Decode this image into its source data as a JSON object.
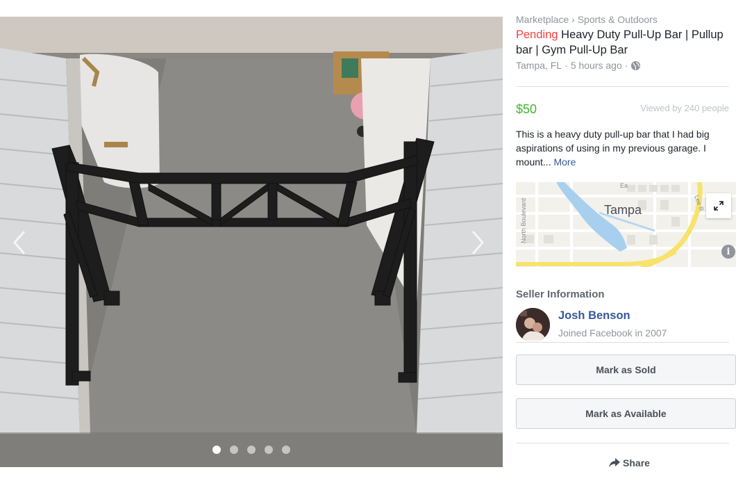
{
  "gallery": {
    "image_alt": "Black heavy duty pull-up bar on concrete floor in storage unit",
    "dots": [
      {
        "active": true
      },
      {
        "active": false
      },
      {
        "active": false
      },
      {
        "active": false
      },
      {
        "active": false
      }
    ],
    "prev_icon": "chevron-left-icon",
    "next_icon": "chevron-right-icon"
  },
  "listing": {
    "breadcrumb": [
      "Marketplace",
      "›",
      "Sports & Outdoors"
    ],
    "status": "Pending",
    "title": "Heavy Duty Pull-Up Bar | Pullup bar | Gym Pull-Up Bar",
    "location": "Tampa, FL",
    "separator": "·",
    "posted": "5 hours ago",
    "privacy_icon": "globe-icon",
    "price": "$50",
    "viewed": "Viewed by 240 people",
    "description": "This is a heavy duty pull-up bar that I had big aspirations of using in my previous garage. I mount...",
    "more_label": "More"
  },
  "map": {
    "city_label": "Tampa",
    "street_left": "North Boulevard",
    "street_top": "Ea",
    "street_right": "Lee R",
    "expand_icon": "expand-icon",
    "info_icon": "info-icon",
    "info_glyph": "i"
  },
  "seller": {
    "heading": "Seller Information",
    "name": "Josh Benson",
    "joined": "Joined Facebook in 2007"
  },
  "actions": {
    "mark_sold": "Mark as Sold",
    "mark_available": "Mark as Available",
    "share": "Share",
    "share_icon": "share-arrow-icon"
  },
  "colors": {
    "pending": "#fa3e3e",
    "price": "#42b72a",
    "link": "#365899"
  }
}
